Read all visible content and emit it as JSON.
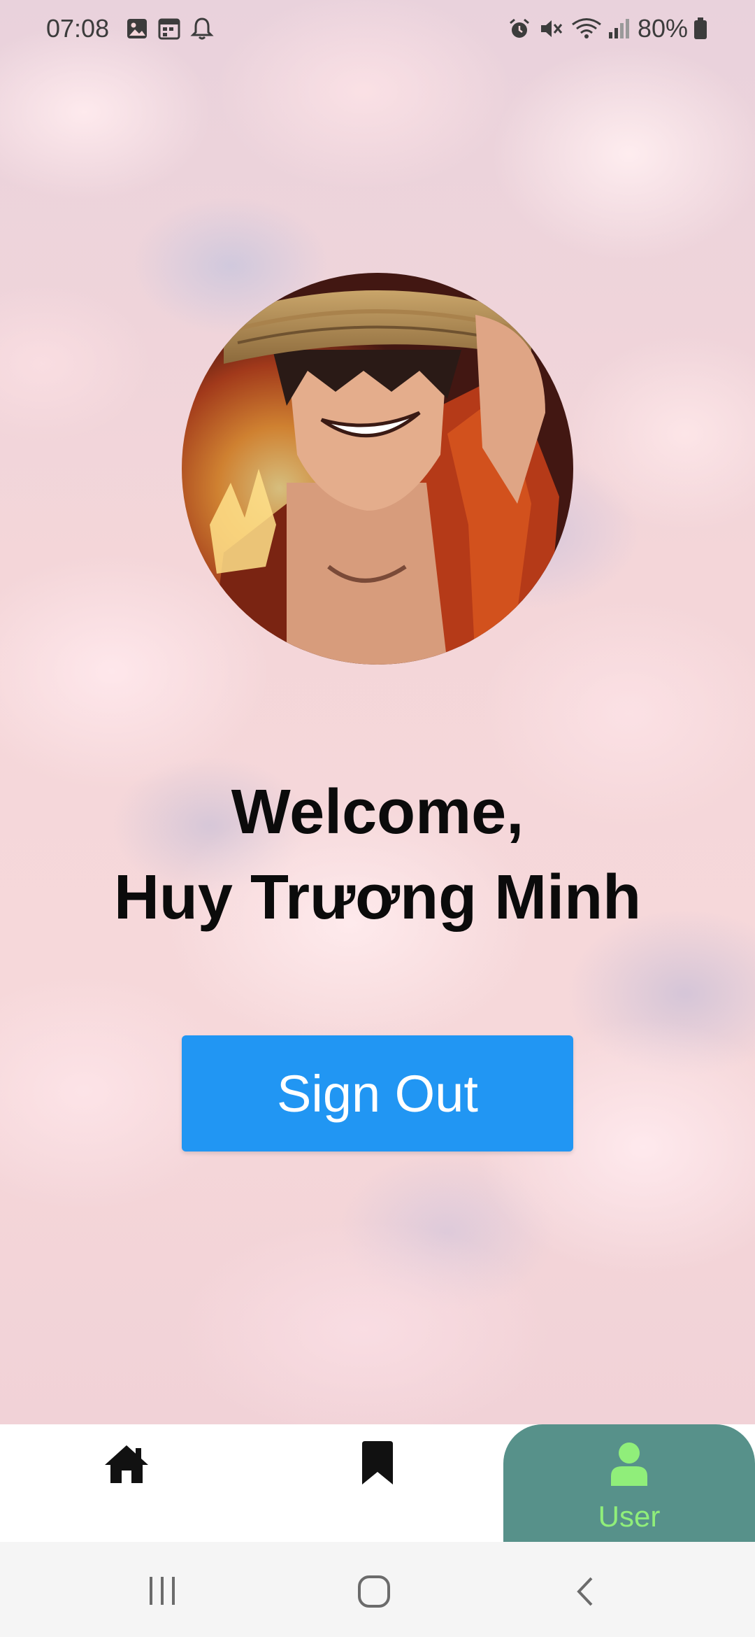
{
  "status_bar": {
    "time": "07:08",
    "battery_percent": "80%",
    "left_icons": [
      "gallery-icon",
      "calendar-icon",
      "notification-bell-icon"
    ],
    "right_icons": [
      "alarm-icon",
      "mute-icon",
      "wifi-icon",
      "signal-icon",
      "battery-icon"
    ]
  },
  "profile": {
    "welcome_line": "Welcome,",
    "user_name": "Huy Trương Minh"
  },
  "actions": {
    "sign_out_label": "Sign Out"
  },
  "bottom_nav": {
    "items": [
      {
        "id": "home",
        "icon": "home-icon",
        "label": ""
      },
      {
        "id": "bookmark",
        "icon": "bookmark-icon",
        "label": ""
      },
      {
        "id": "user",
        "icon": "user-icon",
        "label": "User",
        "active": true
      }
    ]
  },
  "system_nav": {
    "icons": [
      "recent-apps-icon",
      "home-circle-icon",
      "back-icon"
    ]
  },
  "colors": {
    "button_blue": "#2196f3",
    "nav_active_bg": "#57918a",
    "nav_active_fg": "#90ee7a"
  }
}
